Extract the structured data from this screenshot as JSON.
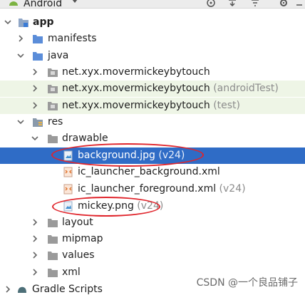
{
  "toolbar": {
    "title": "Android",
    "icons": [
      "globe-target-icon",
      "collapse-all-icon",
      "filter-icon",
      "settings-icon",
      "minimize-icon"
    ]
  },
  "tree": [
    {
      "label": "app",
      "bold": true,
      "expanded": true
    },
    {
      "label": "manifests",
      "expanded": false
    },
    {
      "label": "java",
      "expanded": true
    },
    {
      "label": "net.xyx.movermickeybytouch",
      "expanded": false
    },
    {
      "label": "net.xyx.movermickeybytouch",
      "suffix": "(androidTest)",
      "expanded": false
    },
    {
      "label": "net.xyx.movermickeybytouch",
      "suffix": "(test)",
      "expanded": false
    },
    {
      "label": "res",
      "expanded": true
    },
    {
      "label": "drawable",
      "expanded": true
    },
    {
      "label": "background.jpg",
      "suffix": "(v24)",
      "selected": true
    },
    {
      "label": "ic_launcher_background.xml"
    },
    {
      "label": "ic_launcher_foreground.xml",
      "suffix": "(v24)"
    },
    {
      "label": "mickey.png",
      "suffix": "(v24)"
    },
    {
      "label": "layout",
      "expanded": false
    },
    {
      "label": "mipmap",
      "expanded": false
    },
    {
      "label": "values",
      "expanded": false
    },
    {
      "label": "xml",
      "expanded": false
    },
    {
      "label": "Gradle Scripts",
      "expanded": false
    }
  ],
  "watermark": "CSDN @一个良品铺子",
  "colors": {
    "selection": "#2f6cc6",
    "annotation": "#e0242b",
    "test_row_bg": "#eef5e6"
  }
}
